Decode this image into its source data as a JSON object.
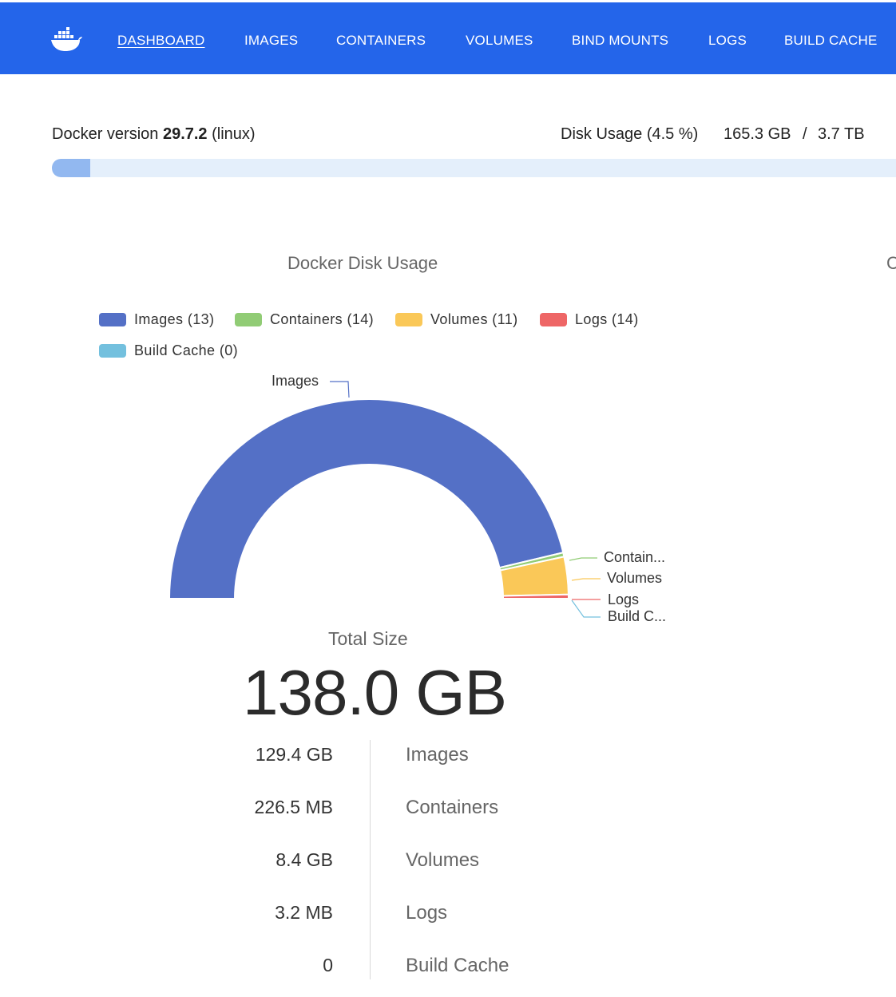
{
  "nav": {
    "items": [
      {
        "label": "DASHBOARD",
        "active": true
      },
      {
        "label": "IMAGES",
        "active": false
      },
      {
        "label": "CONTAINERS",
        "active": false
      },
      {
        "label": "VOLUMES",
        "active": false
      },
      {
        "label": "BIND MOUNTS",
        "active": false
      },
      {
        "label": "LOGS",
        "active": false
      },
      {
        "label": "BUILD CACHE",
        "active": false
      }
    ],
    "logo_icon": "docker-whale-icon"
  },
  "info": {
    "version_prefix": "Docker version",
    "version": "29.7.2",
    "os": "(linux)",
    "disk_usage_label": "Disk Usage (4.5 %)",
    "disk_used": "165.3 GB",
    "separator": "/",
    "disk_total": "3.7 TB",
    "disk_usage_percent": 4.5
  },
  "chart": {
    "title": "Docker Disk Usage",
    "cut_title": "C",
    "legend": [
      {
        "label": "Images (13)",
        "color": "#5470c6"
      },
      {
        "label": "Containers (14)",
        "color": "#91cc75"
      },
      {
        "label": "Volumes (11)",
        "color": "#fac858"
      },
      {
        "label": "Logs (14)",
        "color": "#ee6666"
      },
      {
        "label": "Build Cache (0)",
        "color": "#73c0de"
      }
    ],
    "slice_labels": [
      "Images",
      "Contain...",
      "Volumes",
      "Logs",
      "Build C..."
    ]
  },
  "chart_data": {
    "type": "pie",
    "variant": "half-donut",
    "title": "Docker Disk Usage",
    "unit": "GB",
    "categories": [
      "Images",
      "Containers",
      "Volumes",
      "Logs",
      "Build Cache"
    ],
    "values": [
      129.4,
      0.2265,
      8.4,
      0.0032,
      0
    ],
    "colors": [
      "#5470c6",
      "#91cc75",
      "#fac858",
      "#ee6666",
      "#73c0de"
    ],
    "legend_position": "top"
  },
  "summary": {
    "total_label": "Total Size",
    "total_value": "138.0 GB",
    "rows": [
      {
        "value": "129.4 GB",
        "label": "Images"
      },
      {
        "value": "226.5 MB",
        "label": "Containers"
      },
      {
        "value": "8.4 GB",
        "label": "Volumes"
      },
      {
        "value": "3.2 MB",
        "label": "Logs"
      },
      {
        "value": "0",
        "label": "Build Cache"
      }
    ]
  }
}
